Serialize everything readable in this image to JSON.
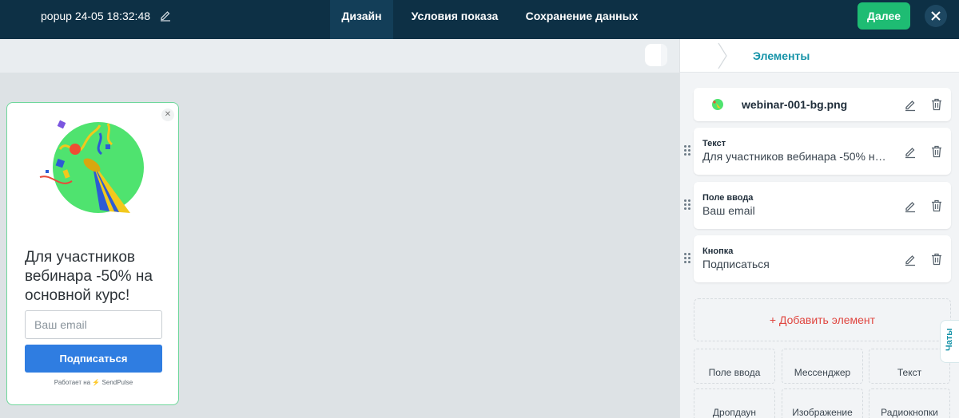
{
  "topbar": {
    "popup_name": "popup 24-05 18:32:48",
    "tabs": [
      {
        "label": "Дизайн",
        "active": true
      },
      {
        "label": "Условия показа",
        "active": false
      },
      {
        "label": "Сохранение данных",
        "active": false
      }
    ],
    "next_label": "Далее"
  },
  "popup": {
    "title": "Для участников вебинара -50% на основной курс!",
    "email_placeholder": "Ваш email",
    "button_label": "Подписаться",
    "powered_prefix": "Работает на",
    "powered_brand": "SendPulse"
  },
  "panel": {
    "title": "Элементы",
    "elements": [
      {
        "type": "image",
        "value": "webinar-001-bg.png"
      },
      {
        "label": "Текст",
        "value": "Для участников вебинара -50% на основной курс!"
      },
      {
        "label": "Поле ввода",
        "value": "Ваш email"
      },
      {
        "label": "Кнопка",
        "value": "Подписаться"
      }
    ],
    "add_element_label": "+ Добавить элемент",
    "tiles": [
      "Поле ввода",
      "Мессенджер",
      "Текст",
      "Дропдаун",
      "Изображение",
      "Радиокнопки"
    ]
  },
  "chats_label": "Чаты",
  "colors": {
    "topbar": "#0d3045",
    "accent_green": "#1ebc73",
    "accent_teal": "#1593a8",
    "popup_button": "#2f7de1",
    "add_element": "#e0453f"
  }
}
